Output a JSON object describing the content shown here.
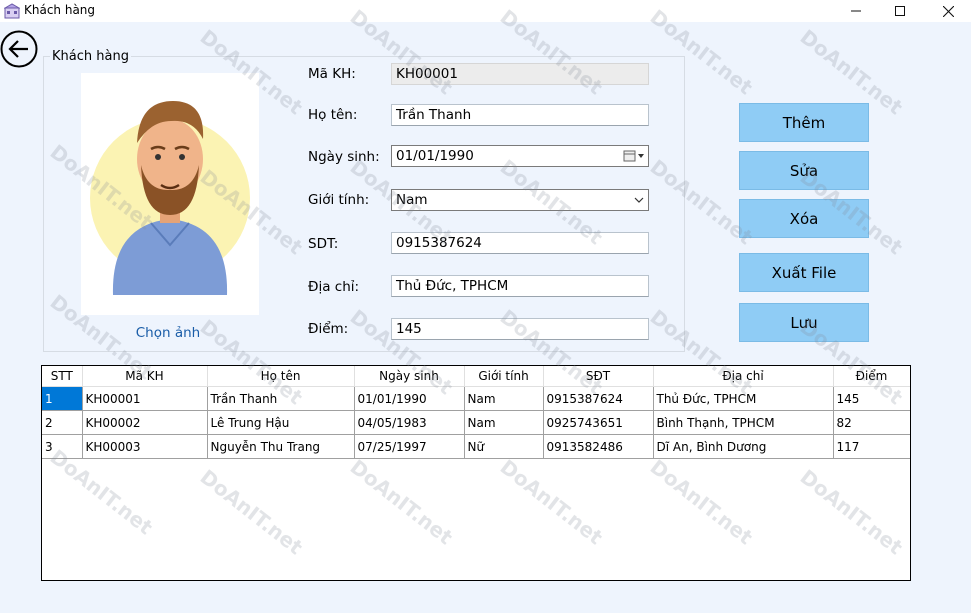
{
  "window": {
    "title": "Khách hàng"
  },
  "group": {
    "label": "Khách hàng"
  },
  "photo": {
    "choose_label": "Chọn ảnh"
  },
  "form": {
    "ma_kh": {
      "label": "Mã KH:",
      "value": "KH00001"
    },
    "ho_ten": {
      "label": "Họ tên:",
      "value": "Trần Thanh"
    },
    "ngay_sinh": {
      "label": "Ngày sinh:",
      "value": "01/01/1990"
    },
    "gioi_tinh": {
      "label": "Giới tính:",
      "value": "Nam"
    },
    "sdt": {
      "label": "SDT:",
      "value": "0915387624"
    },
    "dia_chi": {
      "label": "Địa chỉ:",
      "value": "Thủ Đức, TPHCM"
    },
    "diem": {
      "label": "Điểm:",
      "value": "145"
    }
  },
  "buttons": {
    "them": "Thêm",
    "sua": "Sửa",
    "xoa": "Xóa",
    "xuat_file": "Xuất File",
    "luu": "Lưu"
  },
  "table": {
    "headers": [
      "STT",
      "Mã KH",
      "Họ tên",
      "Ngày sinh",
      "Giới tính",
      "SĐT",
      "Địa chỉ",
      "Điểm"
    ],
    "rows": [
      [
        "1",
        "KH00001",
        "Trần Thanh",
        "01/01/1990",
        "Nam",
        "0915387624",
        "Thủ Đức, TPHCM",
        "145"
      ],
      [
        "2",
        "KH00002",
        "Lê Trung Hậu",
        "04/05/1983",
        "Nam",
        "0925743651",
        "Bình Thạnh, TPHCM",
        "82"
      ],
      [
        "3",
        "KH00003",
        "Nguyễn Thu Trang",
        "07/25/1997",
        "Nữ",
        "0913582486",
        "Dĩ An, Bình Dương",
        "117"
      ]
    ]
  },
  "watermark": {
    "text": "DoAnIT.net"
  },
  "colors": {
    "button_bg": "#8fccf5",
    "selected_cell": "#0078d7",
    "link": "#1a5da8",
    "form_bg": "#eef4fd"
  }
}
